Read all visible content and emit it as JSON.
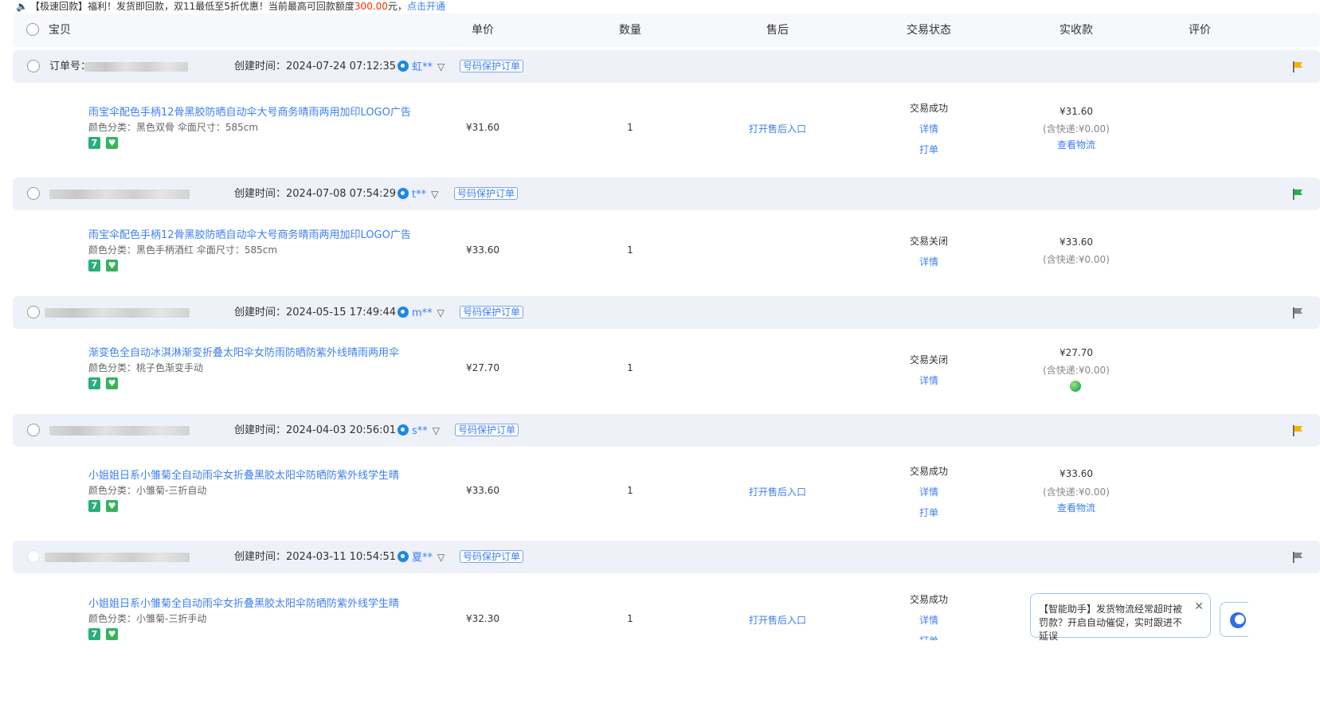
{
  "notice": {
    "prefix": "【极速回款】福利！发货即回款，双11最低至5折优惠！当前最高可回款额度",
    "amount": "300.00",
    "suffix": "元，",
    "link": "点击开通"
  },
  "header": {
    "item": "宝贝",
    "price": "单价",
    "qty": "数量",
    "aftersale": "售后",
    "status": "交易状态",
    "paid": "实收款",
    "review": "评价"
  },
  "labels": {
    "order_no": "订单号：",
    "protect": "号码保护订单",
    "detail": "详情",
    "print": "打单",
    "logistics": "查看物流",
    "aftersale_entry": "打开售后入口"
  },
  "orders": [
    {
      "created": "创建时间：2024-07-24 07:12:35",
      "buyer": "虹**",
      "flag": "#f5b400",
      "title": "雨宝伞配色手柄12骨黑胶防晒自动伞大号商务晴雨两用加印LOGO广告",
      "sku": "颜色分类：黑色双骨   伞面尺寸：585cm",
      "price": "¥31.60",
      "qty": "1",
      "aftersale": "打开售后入口",
      "status": "交易成功",
      "paid": "¥31.60",
      "shipping": "(含快递:¥0.00)"
    },
    {
      "created": "创建时间：2024-07-08 07:54:29",
      "buyer": "t**",
      "flag": "#1fb34a",
      "title": "雨宝伞配色手柄12骨黑胶防晒自动伞大号商务晴雨两用加印LOGO广告",
      "sku": "颜色分类：黑色手柄酒红   伞面尺寸：585cm",
      "price": "¥33.60",
      "qty": "1",
      "status": "交易关闭",
      "paid": "¥33.60",
      "shipping": "(含快递:¥0.00)"
    },
    {
      "created": "创建时间：2024-05-15 17:49:44",
      "buyer": "m**",
      "flag": "#8a8a8a",
      "title": "渐变色全自动冰淇淋渐变折叠太阳伞女防雨防晒防紫外线晴雨两用伞",
      "sku": "颜色分类：桃子色渐变手动",
      "price": "¥27.70",
      "qty": "1",
      "status": "交易关闭",
      "paid": "¥27.70",
      "shipping": "(含快递:¥0.00)"
    },
    {
      "created": "创建时间：2024-04-03 20:56:01",
      "buyer": "s**",
      "flag": "#f5b400",
      "title": "小姐姐日系小雏菊全自动雨伞女折叠黑胶太阳伞防晒防紫外线学生晴",
      "sku": "颜色分类：小雏菊-三折自动",
      "price": "¥33.60",
      "qty": "1",
      "aftersale": "打开售后入口",
      "status": "交易成功",
      "paid": "¥33.60",
      "shipping": "(含快递:¥0.00)"
    },
    {
      "created": "创建时间：2024-03-11 10:54:51",
      "buyer": "夏**",
      "flag": "#8a8a8a",
      "title": "小姐姐日系小雏菊全自动雨伞女折叠黑胶太阳伞防晒防紫外线学生晴",
      "sku": "颜色分类：小雏菊-三折手动",
      "price": "¥32.30",
      "qty": "1",
      "aftersale": "打开售后入口",
      "status": "交易成功"
    }
  ],
  "assistant": {
    "text": "【智能助手】发货物流经常超时被罚款？开启自动催促，实时跟进不延误"
  }
}
